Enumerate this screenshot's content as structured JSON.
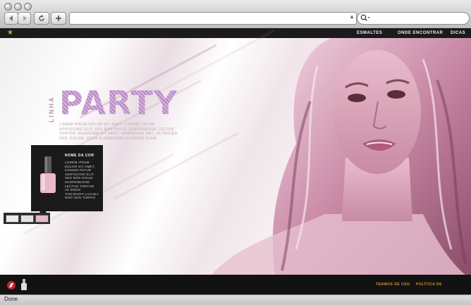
{
  "browser": {
    "status_text": "Done",
    "search_icon": "magnifier-icon",
    "nav_buttons": [
      "back-icon",
      "forward-icon",
      "reload-icon",
      "add-icon"
    ]
  },
  "site": {
    "logo_icon": "star-icon",
    "nav": [
      "ESMALTES",
      "ONDE ENCONTRAR",
      "DICAS"
    ]
  },
  "hero": {
    "line_label": "LINHA",
    "title": "PARTY",
    "description": "LOREM IPSUM DOLOR SIT AMET, CONSECTETUR ADIPISCING ELIT. SED NON RISUS. SUSPENDISSE LECTUS TORTOR, DIGNISSIM SIT AMET, ADIPISCING NEC, ULTRICIES SED, DOLOR. CRAS ELEMENTUM ULTRICES DIAM."
  },
  "popup": {
    "title": "NOME DA COR",
    "text": "LOREM IPSUM DOLOR SIT AMET, CONSECTETUR ADIPISCING ELIT. SED NON RISUS. SUSPENDISSE LECTUS TORTOR AC EROS TINCIDUNT LACINIA NON NON TURPIS."
  },
  "swatches": [
    {
      "name": "white",
      "color": "#ececec"
    },
    {
      "name": "light-grey",
      "color": "#e2e2e2"
    },
    {
      "name": "pink",
      "color": "#e8b9c8"
    }
  ],
  "footer": {
    "links": [
      "TERMOS DE USO",
      "POLÍTICA DE PRIVACIDADE"
    ],
    "brand_icons": [
      "brand-logo-red-icon",
      "brand-logo-bottle-icon"
    ]
  },
  "colors": {
    "accent_gold": "#c7972f",
    "nav_bg": "#1b1b1b",
    "title_pink": "#c89ed0"
  }
}
